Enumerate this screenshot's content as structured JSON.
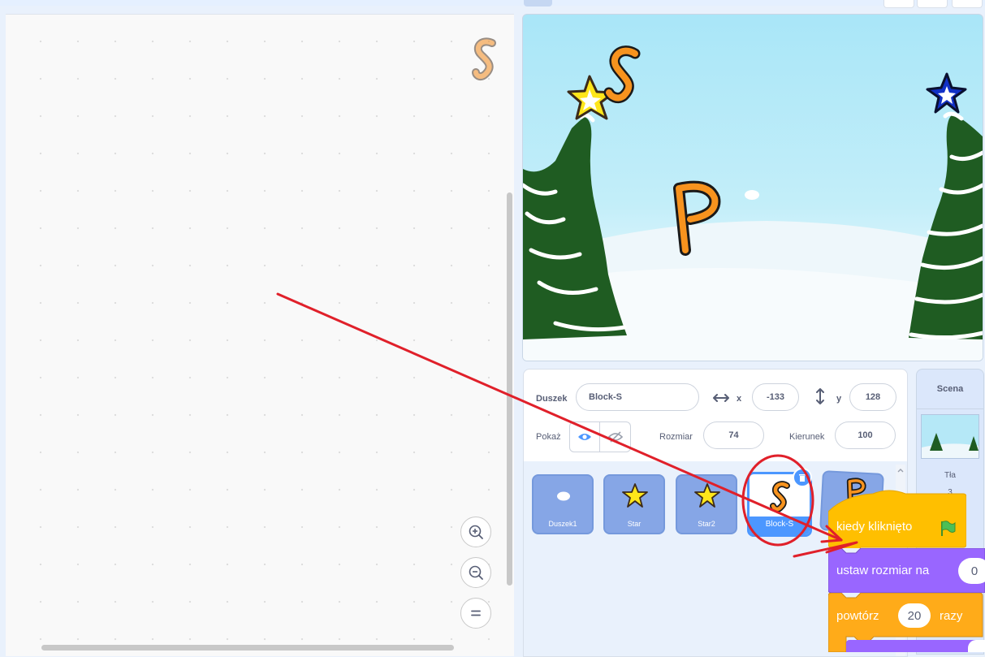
{
  "sprite_info": {
    "sprite_label": "Duszek",
    "sprite_name": "Block-S",
    "x_label": "x",
    "x_value": "-133",
    "y_label": "y",
    "y_value": "128",
    "show_label": "Pokaż",
    "size_label": "Rozmiar",
    "size_value": "74",
    "direction_label": "Kierunek",
    "direction_value": "100"
  },
  "sprites": [
    {
      "name": "Duszek1",
      "icon": "cloud-icon"
    },
    {
      "name": "Star",
      "icon": "star-icon"
    },
    {
      "name": "Star2",
      "icon": "star-icon"
    },
    {
      "name": "Block-S",
      "icon": "letter-s-icon",
      "selected": true
    },
    {
      "name": "",
      "icon": "letter-p-icon"
    }
  ],
  "stage_pane": {
    "title": "Scena",
    "backdrops_label": "Tła",
    "backdrops_count": "3"
  },
  "blocks": {
    "when_flag": "kiedy kliknięto",
    "set_size": "ustaw rozmiar na",
    "set_size_value": "0",
    "repeat": "powtórz",
    "repeat_value": "20",
    "repeat_suffix": "razy"
  },
  "stage_sprites": {
    "letter_s": "S",
    "letter_p": "P"
  },
  "colors": {
    "events_yellow": "#ffbf00",
    "looks_purple": "#9966ff",
    "control_orange": "#ffab19",
    "selection_blue": "#4c97ff",
    "annotation_red": "#e0202a",
    "tree_green": "#1f5c22"
  }
}
